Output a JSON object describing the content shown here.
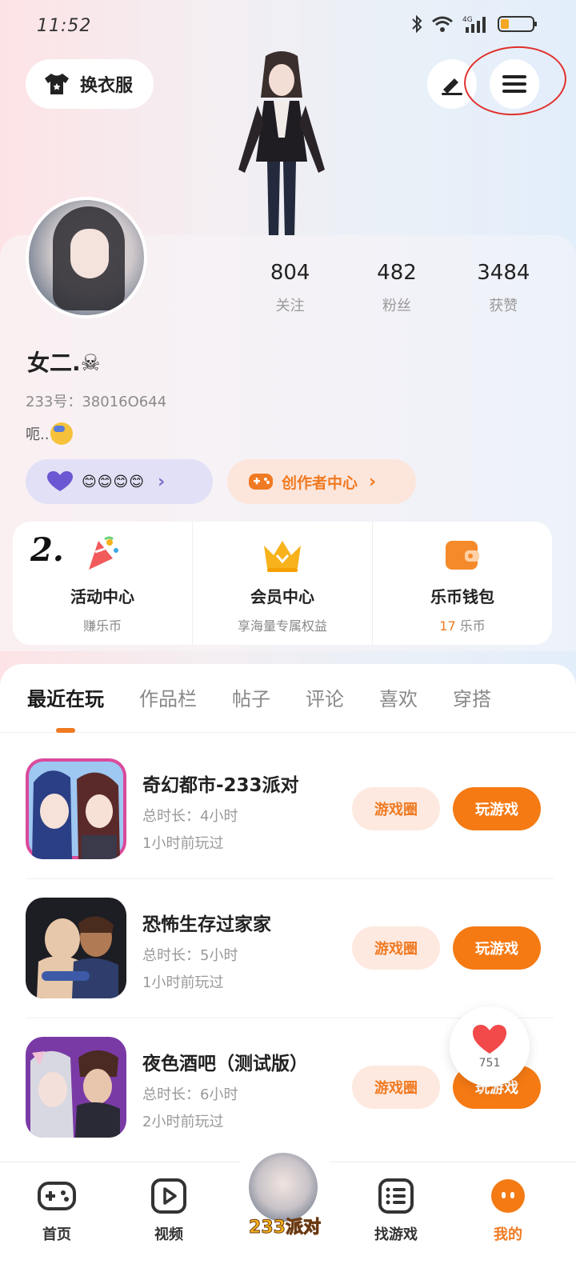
{
  "status_bar": {
    "time": "11:52",
    "icons": [
      "bluetooth-icon",
      "wifi-icon",
      "signal-4g-icon",
      "battery-icon"
    ],
    "network": "4G"
  },
  "header": {
    "outfit_label": "换衣服",
    "edit_icon": "edit-icon",
    "menu_icon": "menu-icon"
  },
  "profile": {
    "username": "女二.☠",
    "user_id": "233号：38016O644",
    "bio": "呃..",
    "stats": [
      {
        "value": "804",
        "label": "关注"
      },
      {
        "value": "482",
        "label": "粉丝"
      },
      {
        "value": "3484",
        "label": "获赞"
      }
    ],
    "heart_pill_emojis": "😊😊😊😊",
    "creator_label": "创作者中心"
  },
  "quick_panel": {
    "annotation": "2.",
    "items": [
      {
        "title": "活动中心",
        "subtitle": "赚乐币"
      },
      {
        "title": "会员中心",
        "subtitle": "享海量专属权益"
      },
      {
        "title": "乐币钱包",
        "subtitle_num": "17",
        "subtitle_unit": "乐币"
      }
    ]
  },
  "tabs": [
    "最近在玩",
    "作品栏",
    "帖子",
    "评论",
    "喜欢",
    "穿搭"
  ],
  "active_tab": "最近在玩",
  "games": [
    {
      "name": "奇幻都市-233派对",
      "duration": "总时长：4小时",
      "last_played": "1小时前玩过",
      "circle_label": "游戏圈",
      "play_label": "玩游戏"
    },
    {
      "name": "恐怖生存过家家",
      "duration": "总时长：5小时",
      "last_played": "1小时前玩过",
      "circle_label": "游戏圈",
      "play_label": "玩游戏"
    },
    {
      "name": "夜色酒吧（测试版）",
      "duration": "总时长：6小时",
      "last_played": "2小时前玩过",
      "circle_label": "游戏圈",
      "play_label": "玩游戏"
    }
  ],
  "float_like": {
    "count": "751"
  },
  "bottom_nav": [
    {
      "label": "首页",
      "icon": "gamepad-icon"
    },
    {
      "label": "视频",
      "icon": "video-icon"
    },
    {
      "label": "233派对",
      "icon": "party-avatar"
    },
    {
      "label": "找游戏",
      "icon": "list-icon"
    },
    {
      "label": "我的",
      "icon": "profile-icon"
    }
  ],
  "colors": {
    "accent": "#f07a22",
    "play_button": "#f57a14",
    "heart_pill": "#e2e0f6",
    "creator_pill": "#fce6dc"
  }
}
